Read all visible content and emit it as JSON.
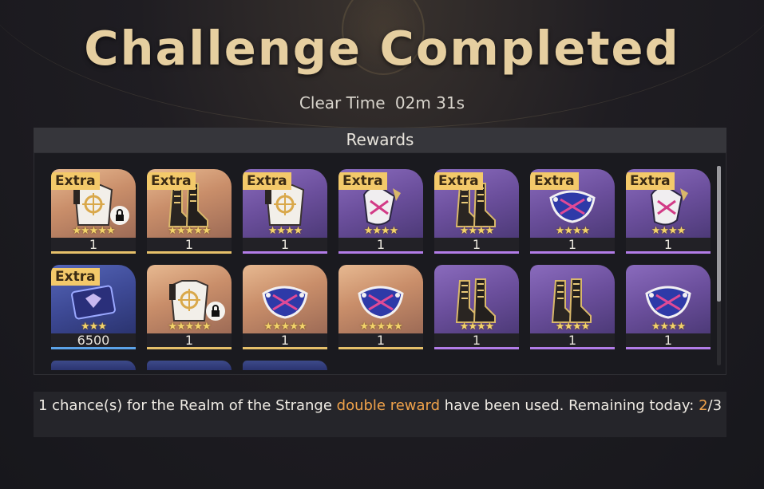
{
  "title": "Challenge Completed",
  "clear_time": {
    "label": "Clear Time",
    "value": "02m 31s"
  },
  "rewards": {
    "header": "Rewards",
    "extra_label": "Extra",
    "items": [
      {
        "extra": true,
        "rarity": "gold",
        "stars": "★★★★★",
        "count": "1",
        "icon": "body-armor-icon",
        "locked": true
      },
      {
        "extra": true,
        "rarity": "gold",
        "stars": "★★★★★",
        "count": "1",
        "icon": "boots-icon",
        "locked": false
      },
      {
        "extra": true,
        "rarity": "purple",
        "stars": "★★★★",
        "count": "1",
        "icon": "body-armor-icon",
        "locked": false
      },
      {
        "extra": true,
        "rarity": "purple",
        "stars": "★★★★",
        "count": "1",
        "icon": "gloves-icon",
        "locked": false
      },
      {
        "extra": true,
        "rarity": "purple",
        "stars": "★★★★",
        "count": "1",
        "icon": "boots-icon",
        "locked": false
      },
      {
        "extra": true,
        "rarity": "purple",
        "stars": "★★★★",
        "count": "1",
        "icon": "mask-icon",
        "locked": false
      },
      {
        "extra": true,
        "rarity": "purple",
        "stars": "★★★★",
        "count": "1",
        "icon": "gloves-icon",
        "locked": false
      },
      {
        "extra": true,
        "rarity": "blue",
        "stars": "★★★",
        "count": "6500",
        "icon": "ticket-icon",
        "locked": false
      },
      {
        "extra": false,
        "rarity": "gold",
        "stars": "★★★★★",
        "count": "1",
        "icon": "body-armor-icon",
        "locked": true
      },
      {
        "extra": false,
        "rarity": "gold",
        "stars": "★★★★★",
        "count": "1",
        "icon": "mask-icon",
        "locked": false
      },
      {
        "extra": false,
        "rarity": "gold",
        "stars": "★★★★★",
        "count": "1",
        "icon": "mask-icon",
        "locked": false
      },
      {
        "extra": false,
        "rarity": "purple",
        "stars": "★★★★",
        "count": "1",
        "icon": "boots-icon",
        "locked": false
      },
      {
        "extra": false,
        "rarity": "purple",
        "stars": "★★★★",
        "count": "1",
        "icon": "boots-icon",
        "locked": false
      },
      {
        "extra": false,
        "rarity": "purple",
        "stars": "★★★★",
        "count": "1",
        "icon": "mask-icon",
        "locked": false
      }
    ]
  },
  "notice": {
    "part1": "1 chance(s) for the Realm of the Strange ",
    "highlight": "double reward",
    "part2": " have been used. Remaining today: ",
    "remaining": "2",
    "total": "/3"
  },
  "colors": {
    "title": "#e6cfa0",
    "highlight": "#f0a24a",
    "gold_bar": "#e6c06a",
    "purple_bar": "#b27ce8",
    "blue_bar": "#5ca3e8"
  }
}
